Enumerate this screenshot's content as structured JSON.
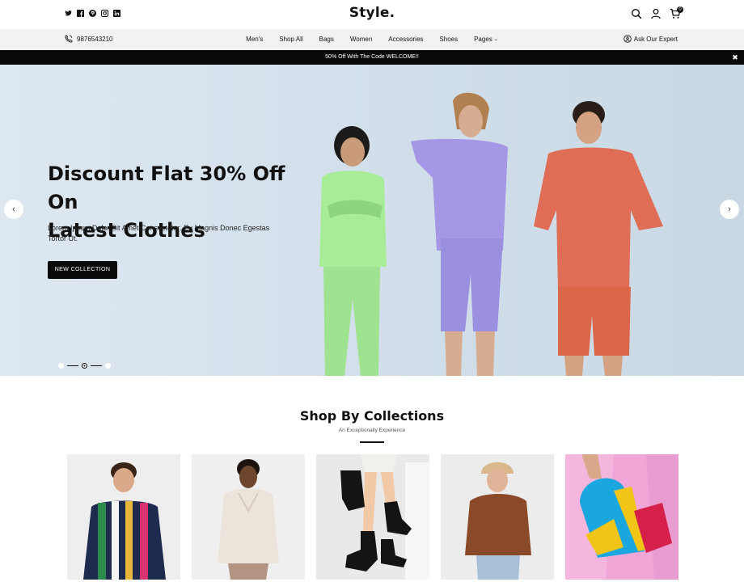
{
  "header": {
    "logo": "Style.",
    "social_icons": [
      "twitter-icon",
      "facebook-icon",
      "pinterest-icon",
      "instagram-icon",
      "linkedin-icon"
    ],
    "icons": [
      "search-icon",
      "user-icon",
      "cart-icon"
    ],
    "cart_count": "0"
  },
  "navbar": {
    "phone": "9876543210",
    "items": [
      {
        "label": "Men's"
      },
      {
        "label": "Shop All"
      },
      {
        "label": "Bags"
      },
      {
        "label": "Women"
      },
      {
        "label": "Accessories"
      },
      {
        "label": "Shoes"
      },
      {
        "label": "Pages"
      }
    ],
    "expert": "Ask Our Expert"
  },
  "promo": {
    "text": "50% Off With The Code WELCOME!!",
    "close": "✖"
  },
  "hero": {
    "title_line1": "Discount Flat 30% Off On",
    "title_line2": "Latest Clothes",
    "subtitle": "Lorem Ipsum Dolor Sit Amet Consectetur. Eu Magnis Donec Egestas Tortor Ut.",
    "button": "NEW COLLECTION",
    "prev": "‹",
    "next": "›",
    "slides": 3,
    "active_slide": 2
  },
  "collections": {
    "title": "Shop By Collections",
    "subtitle": "An Exceptionally Experience",
    "cards": [
      "striped-shirt-photo",
      "hoodie-photo",
      "boots-photo",
      "beanie-sweater-photo",
      "bag-shoes-photo"
    ]
  },
  "colors": {
    "accent": "#0a0a0a",
    "hero_bg": "#d3e0eb",
    "navbar_bg": "#f2f2f2"
  }
}
